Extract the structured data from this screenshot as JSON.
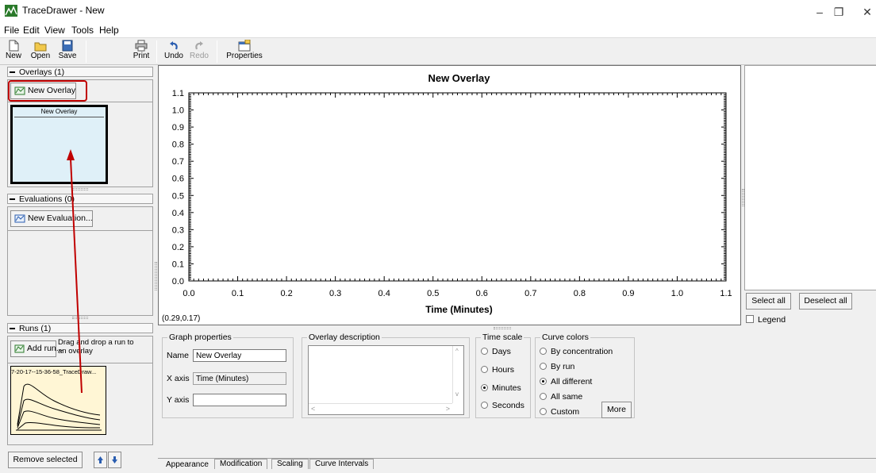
{
  "window": {
    "title": "TraceDrawer - New",
    "minimize": "–",
    "maximize": "❐",
    "close": "✕"
  },
  "menu": [
    "File",
    "Edit",
    "View",
    "Tools",
    "Help"
  ],
  "toolbar": {
    "new": "New",
    "open": "Open",
    "save": "Save",
    "print": "Print",
    "undo": "Undo",
    "redo": "Redo",
    "properties": "Properties"
  },
  "sidebar": {
    "overlays_header": "Overlays (1)",
    "new_overlay_button": "New Overlay",
    "overlay_thumb_title": "New Overlay",
    "evaluations_header": "Evaluations (0)",
    "new_evaluation_button": "New Evaluation...",
    "runs_header": "Runs (1)",
    "add_run_button": "Add run...",
    "drag_hint": "Drag and drop a run to an overlay",
    "run_thumb_title": "7-20-17--15-36-58_TraceDraw...",
    "remove_selected_button": "Remove selected"
  },
  "chart_data": {
    "type": "line",
    "title": "New Overlay",
    "xlabel": "Time (Minutes)",
    "ylabel": "",
    "xlim": [
      0.0,
      1.1
    ],
    "ylim": [
      0.0,
      1.1
    ],
    "xticks": [
      "0.0",
      "0.1",
      "0.2",
      "0.3",
      "0.4",
      "0.5",
      "0.6",
      "0.7",
      "0.8",
      "0.9",
      "1.0",
      "1.1"
    ],
    "yticks": [
      "0.0",
      "0.1",
      "0.2",
      "0.3",
      "0.4",
      "0.5",
      "0.6",
      "0.7",
      "0.8",
      "0.9",
      "1.0",
      "1.1"
    ],
    "series": [],
    "cursor_readout": "(0.29,0.17)"
  },
  "right_panel": {
    "select_all": "Select all",
    "deselect_all": "Deselect all",
    "legend_label": "Legend"
  },
  "graph_properties": {
    "title": "Graph properties",
    "name_label": "Name",
    "name_value": "New Overlay",
    "xaxis_label": "X axis",
    "xaxis_value": "Time (Minutes)",
    "yaxis_label": "Y axis",
    "yaxis_value": ""
  },
  "overlay_description": {
    "title": "Overlay description"
  },
  "time_scale": {
    "title": "Time scale",
    "options": [
      "Days",
      "Hours",
      "Minutes",
      "Seconds"
    ],
    "selected": "Minutes"
  },
  "curve_colors": {
    "title": "Curve colors",
    "options": [
      "By concentration",
      "By run",
      "All different",
      "All same",
      "Custom"
    ],
    "selected": "All different",
    "more_button": "More"
  },
  "tabs": [
    "Appearance",
    "Modification",
    "Scaling",
    "Curve Intervals"
  ],
  "colors": {
    "highlight_red": "#c00000",
    "overlay_thumb_bg": "#dff0f8",
    "run_thumb_bg": "#fff6d5"
  }
}
